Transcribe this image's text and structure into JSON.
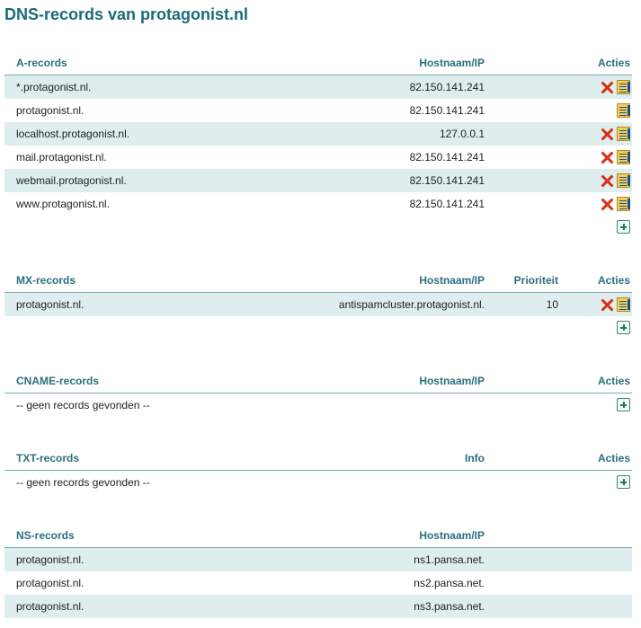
{
  "page": {
    "title": "DNS-records van protagonist.nl"
  },
  "a_records": {
    "headers": {
      "name": "A-records",
      "host": "Hostnaam/IP",
      "actions": "Acties"
    },
    "rows": [
      {
        "name": "*.protagonist.nl.",
        "host": "82.150.141.241",
        "deletable": true
      },
      {
        "name": "protagonist.nl.",
        "host": "82.150.141.241",
        "deletable": false
      },
      {
        "name": "localhost.protagonist.nl.",
        "host": "127.0.0.1",
        "deletable": true
      },
      {
        "name": "mail.protagonist.nl.",
        "host": "82.150.141.241",
        "deletable": true
      },
      {
        "name": "webmail.protagonist.nl.",
        "host": "82.150.141.241",
        "deletable": true
      },
      {
        "name": "www.protagonist.nl.",
        "host": "82.150.141.241",
        "deletable": true
      }
    ]
  },
  "mx_records": {
    "headers": {
      "name": "MX-records",
      "host": "Hostnaam/IP",
      "priority": "Prioriteit",
      "actions": "Acties"
    },
    "rows": [
      {
        "name": "protagonist.nl.",
        "host": "antispamcluster.protagonist.nl.",
        "priority": "10"
      }
    ]
  },
  "cname_records": {
    "headers": {
      "name": "CNAME-records",
      "host": "Hostnaam/IP",
      "actions": "Acties"
    },
    "empty": "-- geen records gevonden --"
  },
  "txt_records": {
    "headers": {
      "name": "TXT-records",
      "info": "Info",
      "actions": "Acties"
    },
    "empty": "-- geen records gevonden --"
  },
  "ns_records": {
    "headers": {
      "name": "NS-records",
      "host": "Hostnaam/IP"
    },
    "rows": [
      {
        "name": "protagonist.nl.",
        "host": "ns1.pansa.net."
      },
      {
        "name": "protagonist.nl.",
        "host": "ns2.pansa.net."
      },
      {
        "name": "protagonist.nl.",
        "host": "ns3.pansa.net."
      }
    ]
  },
  "icons": {
    "delete": "delete-icon",
    "edit": "edit-icon",
    "add": "add-icon"
  },
  "colors": {
    "title": "#1b6a7a",
    "header": "#2a6f7e",
    "row_shade": "#deeeee",
    "delete": "#d8321b"
  }
}
